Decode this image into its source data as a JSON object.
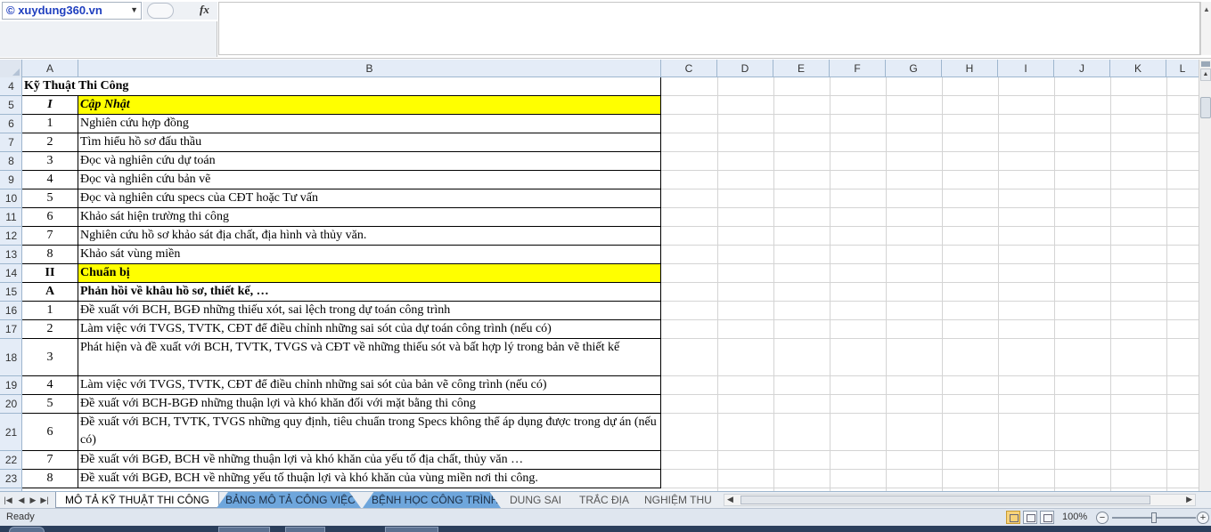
{
  "name_box": {
    "value": "© xuydung360.vn"
  },
  "formula_bar": {
    "fx_label": "fx",
    "content": ""
  },
  "columns": [
    "A",
    "B",
    "C",
    "D",
    "E",
    "F",
    "G",
    "H",
    "I",
    "J",
    "K",
    "L"
  ],
  "rows": [
    {
      "num": "4",
      "a": "",
      "b": "Kỹ Thuật Thi Công",
      "style": "title"
    },
    {
      "num": "5",
      "a": "I",
      "b": "Cập Nhật",
      "style": "section"
    },
    {
      "num": "6",
      "a": "1",
      "b": "Nghiên cứu hợp đồng"
    },
    {
      "num": "7",
      "a": "2",
      "b": "Tìm hiểu hồ sơ đấu thầu"
    },
    {
      "num": "8",
      "a": "3",
      "b": "Đọc và nghiên cứu dự toán"
    },
    {
      "num": "9",
      "a": "4",
      "b": "Đọc và nghiên cứu bản vẽ"
    },
    {
      "num": "10",
      "a": "5",
      "b": "Đọc và nghiên cứu specs của CĐT hoặc Tư vấn"
    },
    {
      "num": "11",
      "a": "6",
      "b": "Khảo sát hiện trường thi công"
    },
    {
      "num": "12",
      "a": "7",
      "b": "Nghiên cứu hồ sơ khảo sát địa chất, địa hình và thủy văn."
    },
    {
      "num": "13",
      "a": "8",
      "b": "Khảo sát vùng miền"
    },
    {
      "num": "14",
      "a": "II",
      "b": "Chuẩn bị",
      "style": "section2"
    },
    {
      "num": "15",
      "a": "A",
      "b": "Phản hồi về khâu hồ sơ, thiết kế, …",
      "style": "subhead"
    },
    {
      "num": "16",
      "a": "1",
      "b": "Đề xuất với BCH, BGĐ những thiếu xót, sai lệch trong dự toán công trình"
    },
    {
      "num": "17",
      "a": "2",
      "b": "Làm việc với TVGS, TVTK, CĐT để điều chỉnh những sai sót của dự toán công trình (nếu có)"
    },
    {
      "num": "18",
      "a": "3",
      "b": "Phát hiện và đề xuất với BCH, TVTK, TVGS và CĐT về những thiếu sót và bất hợp lý trong bản vẽ thiết kế",
      "tall": true
    },
    {
      "num": "19",
      "a": "4",
      "b": "Làm việc với TVGS, TVTK, CĐT để điều chỉnh những sai sót của bản vẽ công trình (nếu có)"
    },
    {
      "num": "20",
      "a": "5",
      "b": "Đề xuất với BCH-BGĐ những thuận lợi và khó khăn đối với mặt bằng thi công"
    },
    {
      "num": "21",
      "a": "6",
      "b": "Đề xuất với BCH, TVTK, TVGS những quy định, tiêu chuẩn trong Specs không thể áp dụng được trong dự án (nếu có)",
      "tall": true
    },
    {
      "num": "22",
      "a": "7",
      "b": "Đề xuất với BGĐ, BCH về những thuận lợi và khó khăn của yếu tố địa chất, thủy văn …"
    },
    {
      "num": "23",
      "a": "8",
      "b": "Đề xuất với BGĐ, BCH về những yếu tố thuận lợi và khó khăn của vùng miền nơi thi công."
    }
  ],
  "sheet_tabs": [
    {
      "label": "MÔ TẢ KỸ THUẬT THI CÔNG",
      "state": "active"
    },
    {
      "label": "BẢNG MÔ TẢ CÔNG VIỆC",
      "state": "blue"
    },
    {
      "label": "BỆNH HỌC CÔNG TRÌNH",
      "state": "blue"
    },
    {
      "label": "DUNG SAI",
      "state": "plain"
    },
    {
      "label": "TRẮC ĐỊA",
      "state": "plain"
    },
    {
      "label": "NGHIỆM THU",
      "state": "plain"
    }
  ],
  "status": {
    "text": "Ready",
    "zoom": "100%"
  },
  "colors": {
    "highlight": "#ffff00",
    "header_bg": "#e4ecf7",
    "tab_blue": "#6ea6dc"
  }
}
